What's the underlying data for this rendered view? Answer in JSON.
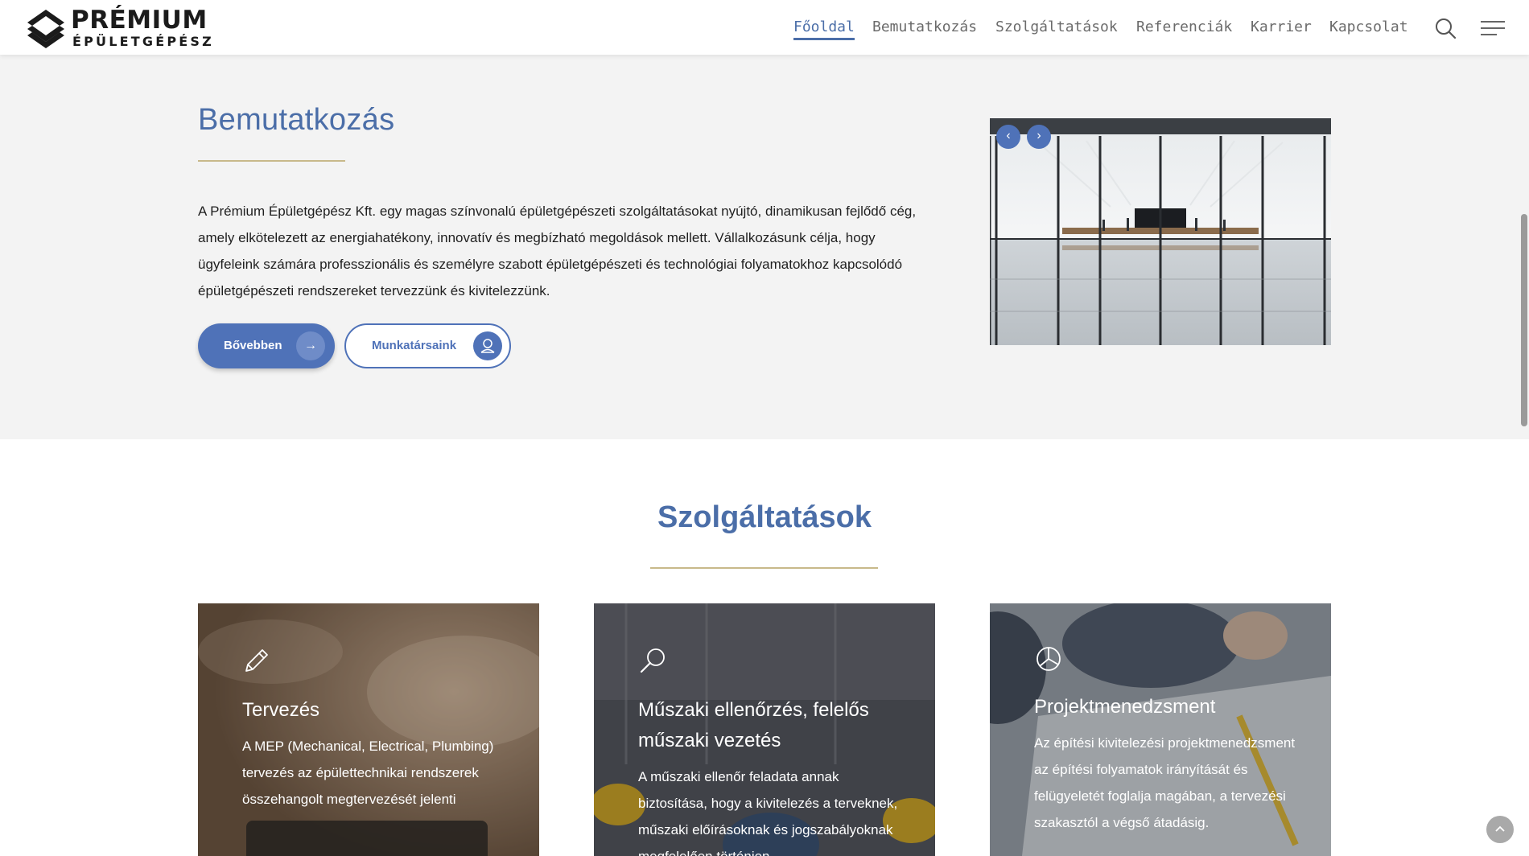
{
  "header": {
    "logo_top": "PRÉMIUM",
    "logo_bottom": "ÉPÜLETGÉPÉSZ",
    "nav": [
      {
        "label": "Főoldal",
        "active": true
      },
      {
        "label": "Bemutatkozás",
        "active": false
      },
      {
        "label": "Szolgáltatások",
        "active": false
      },
      {
        "label": "Referenciák",
        "active": false
      },
      {
        "label": "Karrier",
        "active": false
      },
      {
        "label": "Kapcsolat",
        "active": false
      }
    ],
    "icons": [
      "search-icon",
      "menu-icon"
    ]
  },
  "intro": {
    "title": "Bemutatkozás",
    "text": "A Prémium Épületgépész Kft. egy magas színvonalú épületgépészeti szolgáltatásokat nyújtó, dinamikusan fejlődő cég, amely elkötelezett az energiahatékony, innovatív és megbízható megoldások mellett. Vállalkozásunk célja, hogy ügyfeleink számára professzionális és személyre szabott épületgépészeti és  technológiai folyamatokhoz kapcsolódó épületgépészeti rendszereket tervezzünk és  kivitelezzünk.",
    "btn_more": "Bővebben",
    "btn_team": "Munkatársaink"
  },
  "services": {
    "title": "Szolgáltatások",
    "cards": [
      {
        "icon": "pencil-icon",
        "title": "Tervezés",
        "desc": "A MEP (Mechanical, Electrical, Plumbing) tervezés az épülettechnikai rendszerek összehangolt megtervezését jelenti"
      },
      {
        "icon": "magnifier-icon",
        "title": "Műszaki ellenőrzés, felelős műszaki vezetés",
        "desc": "A műszaki ellenőr feladata annak biztosítása, hogy a kivitelezés a terveknek, műszaki előírásoknak és jogszabályoknak megfelelően történjen"
      },
      {
        "icon": "pie-chart-icon",
        "title": "Projektmenedzsment",
        "desc": "Az építési kivitelezési projektmenedzsment az építési folyamatok irányítását és felügyeletét foglalja magában, a tervezési szakasztól a végső átadásig."
      }
    ]
  },
  "colors": {
    "accent": "#4b6ea8",
    "button": "#4f72b8",
    "gold_rule": "#c8b98a",
    "intro_bg": "#f3f3f3"
  }
}
